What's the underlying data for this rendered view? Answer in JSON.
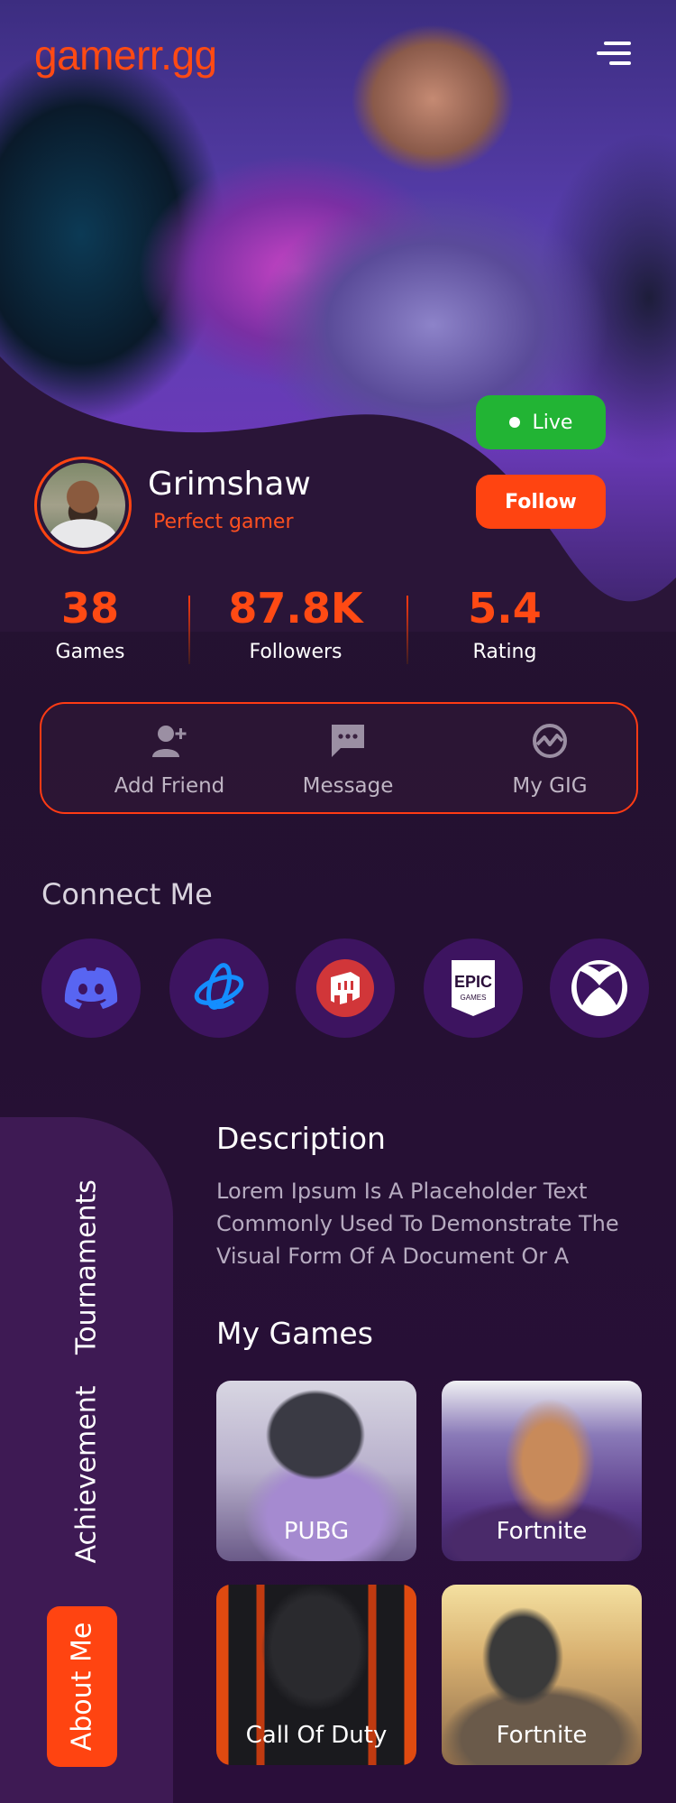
{
  "brand": {
    "logo_text": "gamerr.gg",
    "accent": "#ff4411"
  },
  "header": {
    "menu_icon": "menu-icon"
  },
  "profile": {
    "name": "Grimshaw",
    "tagline": "Perfect gamer",
    "live_label": "Live",
    "follow_label": "Follow"
  },
  "stats": [
    {
      "value": "38",
      "label": "Games"
    },
    {
      "value": "87.8K",
      "label": "Followers"
    },
    {
      "value": "5.4",
      "label": "Rating"
    }
  ],
  "actions": [
    {
      "label": "Add Friend",
      "icon": "add-friend-icon"
    },
    {
      "label": "Message",
      "icon": "message-icon"
    },
    {
      "label": "My GIG",
      "icon": "gig-icon"
    }
  ],
  "connect": {
    "title": "Connect Me",
    "platforms": [
      "discord-icon",
      "battlenet-icon",
      "riot-icon",
      "epic-games-icon",
      "xbox-icon"
    ],
    "epic_text_top": "EPIC",
    "epic_text_bottom": "GAMES"
  },
  "side_tabs": {
    "tournaments": "Tournaments",
    "achievement": "Achievement",
    "about": "About Me"
  },
  "description": {
    "title": "Description",
    "text": "Lorem Ipsum Is A Placeholder Text Commonly Used To Demonstrate The Visual Form Of A Document Or A"
  },
  "games": {
    "title": "My Games",
    "items": [
      {
        "name": "PUBG"
      },
      {
        "name": "Fortnite"
      },
      {
        "name": "Call Of Duty"
      },
      {
        "name": "Fortnite"
      }
    ]
  }
}
